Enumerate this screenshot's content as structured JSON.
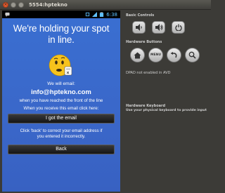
{
  "window": {
    "title": "5554:hptekno",
    "close_glyph": "×"
  },
  "statusbar": {
    "time": "6:38"
  },
  "screen": {
    "headline_line1": "We're holding your spot",
    "headline_line2": "in line.",
    "will_email": "We will email:",
    "email": "info@hptekno.com",
    "front_of_line": "when you have reached the front of the line",
    "receive_prompt": "When you receive this email click here:",
    "got_email_button": "I got the email",
    "back_note_line1": "Click 'back' to correct your email address if",
    "back_note_line2": "you entered it incorrectly.",
    "back_button": "Back"
  },
  "controls": {
    "basic_label": "Basic Controls",
    "hardware_buttons_label": "Hardware Buttons",
    "menu_label": "MENU",
    "dpad_label": "DPAD not enabled in AVD",
    "keyboard_label": "Hardware Keyboard",
    "keyboard_desc": "Use your physical keyboard to provide input"
  },
  "colors": {
    "screen_bg": "#3a6fd1",
    "button_bg": "#1e1e1e",
    "status_time": "#5fc0ff"
  }
}
